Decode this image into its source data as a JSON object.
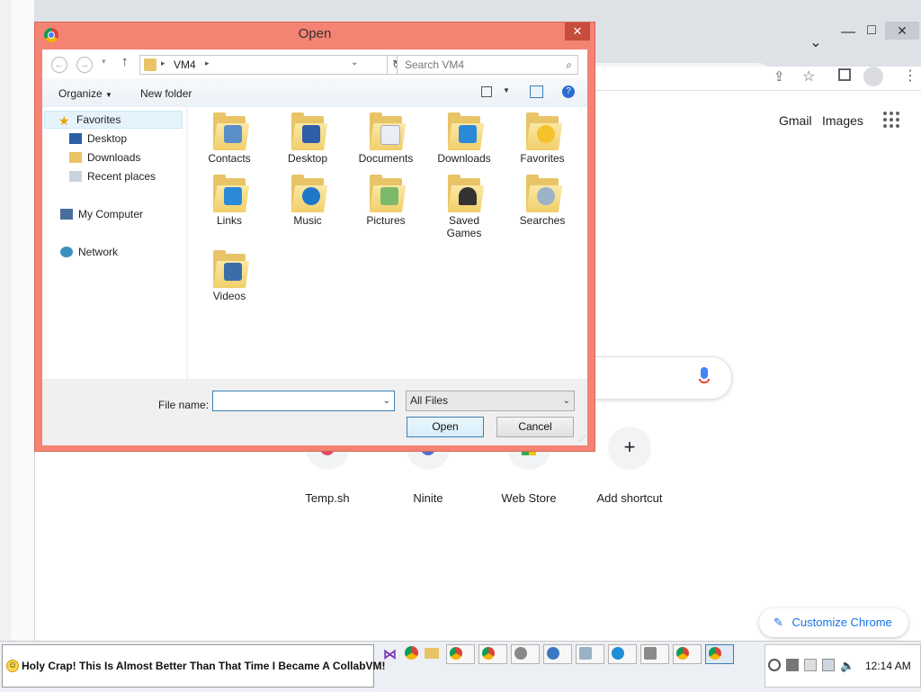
{
  "browser": {
    "top_links": {
      "gmail": "Gmail",
      "images": "Images"
    },
    "shortcuts": [
      {
        "label": "Temp.sh",
        "color": "#e04b6b"
      },
      {
        "label": "Ninite",
        "color": "#4285f4"
      },
      {
        "label": "Web Store",
        "color": "#34a853"
      },
      {
        "label": "Add shortcut",
        "icon": "+"
      }
    ],
    "customize_label": "Customize Chrome"
  },
  "dialog": {
    "title": "Open",
    "close_glyph": "✕",
    "address": {
      "path": "VM4",
      "search_placeholder": "Search VM4"
    },
    "commands": {
      "organize": "Organize",
      "new_folder": "New folder"
    },
    "nav": {
      "favorites": "Favorites",
      "desktop": "Desktop",
      "downloads": "Downloads",
      "recent_places": "Recent places",
      "my_computer": "My Computer",
      "network": "Network"
    },
    "folders": [
      {
        "label": "Contacts",
        "accent": "#5b8fc9"
      },
      {
        "label": "Desktop",
        "accent": "#2e5ea8"
      },
      {
        "label": "Documents",
        "accent": "#e9eef5"
      },
      {
        "label": "Downloads",
        "accent": "#2a8ad8"
      },
      {
        "label": "Favorites",
        "accent": "#f5c22b"
      },
      {
        "label": "Links",
        "accent": "#2a8ad8"
      },
      {
        "label": "Music",
        "accent": "#1f78c8"
      },
      {
        "label": "Pictures",
        "accent": "#7cb96b"
      },
      {
        "label": "Saved Games",
        "accent": "#333333"
      },
      {
        "label": "Searches",
        "accent": "#9ab3c9"
      },
      {
        "label": "Videos",
        "accent": "#3a6ea8"
      }
    ],
    "file_name_label": "File name:",
    "file_name_value": "",
    "filter": "All Files",
    "open_label": "Open",
    "cancel_label": "Cancel"
  },
  "taskbar": {
    "status_text": "Holy Crap! This Is Almost Better Than That Time I Became A CollabVM!",
    "clock": "12:14 AM"
  }
}
